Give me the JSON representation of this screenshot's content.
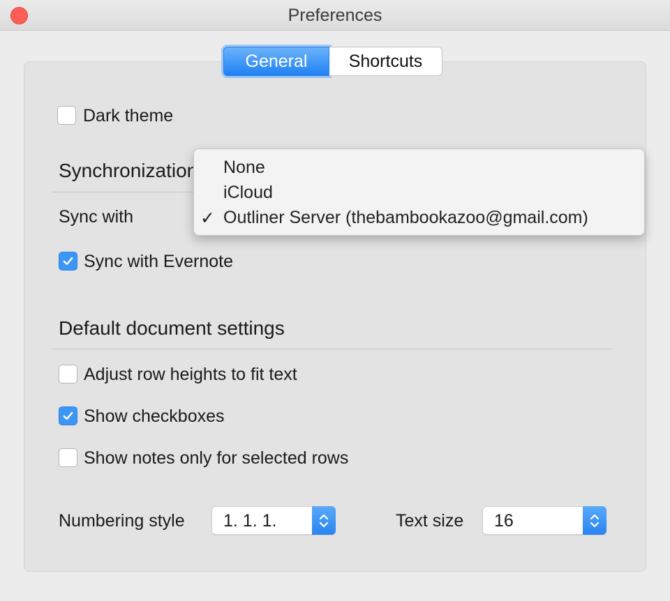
{
  "window": {
    "title": "Preferences"
  },
  "tabs": [
    {
      "label": "General",
      "active": true
    },
    {
      "label": "Shortcuts",
      "active": false
    }
  ],
  "general": {
    "dark_theme": {
      "label": "Dark theme",
      "checked": false
    },
    "sync_section": {
      "heading": "Synchronization",
      "sync_with_label": "Sync with",
      "sync_evernote": {
        "label": "Sync with Evernote",
        "checked": true
      },
      "dropdown": {
        "options": [
          "None",
          "iCloud",
          "Outliner Server (thebambookazoo@gmail.com)"
        ],
        "selected_index": 2,
        "check_glyph": "✓"
      }
    },
    "doc_section": {
      "heading": "Default document settings",
      "adjust_row_heights": {
        "label": "Adjust row heights to fit text",
        "checked": false
      },
      "show_checkboxes": {
        "label": "Show checkboxes",
        "checked": true
      },
      "show_notes_selected": {
        "label": "Show notes only for selected rows",
        "checked": false
      }
    },
    "numbering_style": {
      "label": "Numbering style",
      "value": "1. 1. 1."
    },
    "text_size": {
      "label": "Text size",
      "value": "16"
    }
  },
  "colors": {
    "accent": "#3d95f5",
    "close_button": "#fc5f57"
  },
  "icons": {
    "close": "close-icon",
    "checkmark": "checkmark-icon",
    "stepper": "up-down-chevron-icon"
  }
}
